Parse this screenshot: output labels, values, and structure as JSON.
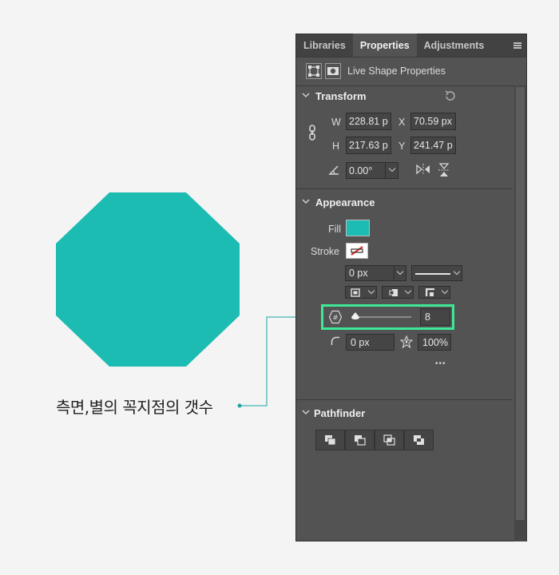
{
  "annotation": {
    "label": "측면,별의 꼭지점의 갯수"
  },
  "colors": {
    "shape_fill": "#1dbcb2",
    "highlight": "#3ee896",
    "callout": "#1aa6a0",
    "panel_bg": "#535353"
  },
  "panel": {
    "tabs": [
      "Libraries",
      "Properties",
      "Adjustments"
    ],
    "active_tab": "Properties",
    "header_title": "Live Shape Properties",
    "transform": {
      "title": "Transform",
      "w_label": "W",
      "w_value": "228.81 p",
      "x_label": "X",
      "x_value": "70.59 px",
      "h_label": "H",
      "h_value": "217.63 p",
      "y_label": "Y",
      "y_value": "241.47 p",
      "angle_value": "0.00°"
    },
    "appearance": {
      "title": "Appearance",
      "fill_label": "Fill",
      "stroke_label": "Stroke",
      "stroke_width": "0 px",
      "sides_value": "8",
      "sides_slider": 0.05,
      "corner_radius": "0 px",
      "star_ratio": "100%",
      "more": "•••"
    },
    "pathfinder": {
      "title": "Pathfinder",
      "buttons": [
        "combine-shapes",
        "subtract-front-shape",
        "intersect-shape-areas",
        "exclude-overlapping-shapes"
      ]
    }
  }
}
